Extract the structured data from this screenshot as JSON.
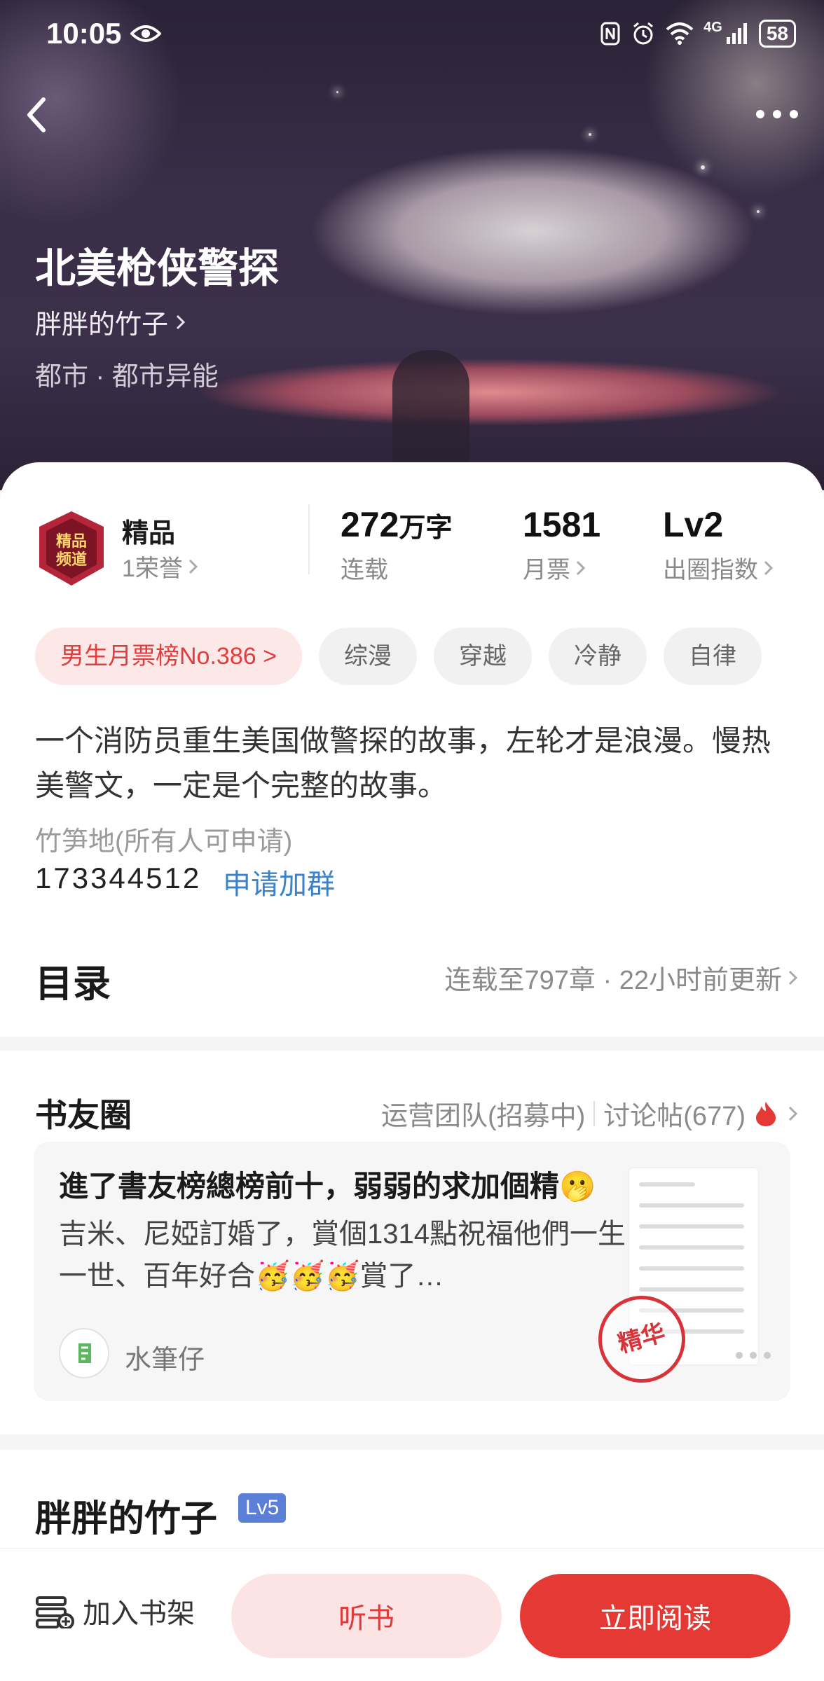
{
  "status_bar": {
    "time": "10:05",
    "network": "4G",
    "battery": "58"
  },
  "book": {
    "title": "北美枪侠警探",
    "author": "胖胖的竹子",
    "genre": "都市 · 都市异能"
  },
  "stats": {
    "quality_label": "精品",
    "honor": "1荣誉",
    "words_num": "272",
    "words_unit": "万字",
    "words_label": "连载",
    "monthly_votes": "1581",
    "monthly_votes_label": "月票",
    "level": "Lv2",
    "level_label": "出圈指数"
  },
  "tags": [
    "男生月票榜No.386 >",
    "综漫",
    "穿越",
    "冷静",
    "自律"
  ],
  "description": "一个消防员重生美国做警探的故事，左轮才是浪漫。慢热美警文，一定是个完整的故事。",
  "group": {
    "name": "竹笋地(所有人可申请)",
    "number": "173344512",
    "join_label": "申请加群"
  },
  "toc": {
    "title": "目录",
    "status": "连载至797章 · 22小时前更新"
  },
  "circle": {
    "title": "书友圈",
    "team": "运营团队(招募中)",
    "posts_count": "讨论帖(677)",
    "post": {
      "title": "進了書友榜總榜前十，弱弱的求加個精🫢",
      "body": "吉米、尼婭訂婚了，賞個1314點祝福他們一生一世、百年好合🥳🥳🥳賞了…",
      "author": "水筆仔",
      "stamp": "精华"
    }
  },
  "author_section": {
    "name": "胖胖的竹子",
    "level": "Lv5"
  },
  "bottom_bar": {
    "shelf_label": "加入书架",
    "listen_label": "听书",
    "read_label": "立即阅读"
  },
  "colors": {
    "accent": "#e53935",
    "link": "#3b82c8",
    "tag_rank_bg": "#fde8e8"
  }
}
